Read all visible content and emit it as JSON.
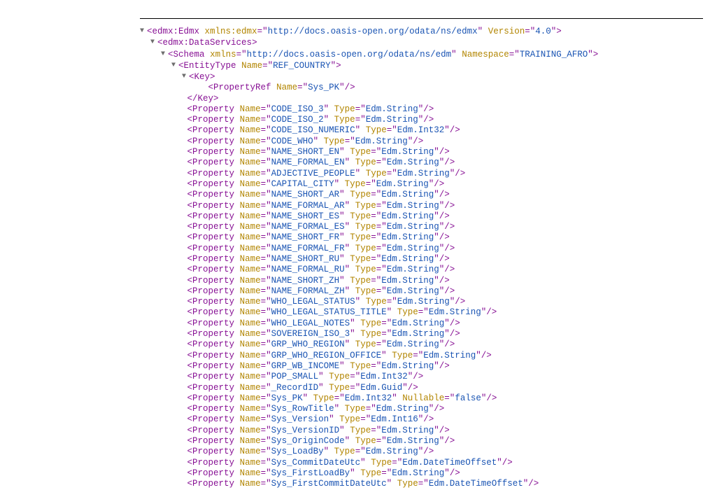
{
  "root": {
    "tag": "edmx:Edmx",
    "attrs": [
      {
        "name": "xmlns:edmx",
        "value": "http://docs.oasis-open.org/odata/ns/edmx"
      },
      {
        "name": "Version",
        "value": "4.0"
      }
    ]
  },
  "dataservices": {
    "tag": "edmx:DataServices"
  },
  "schema": {
    "tag": "Schema",
    "attrs": [
      {
        "name": "xmlns",
        "value": "http://docs.oasis-open.org/odata/ns/edm"
      },
      {
        "name": "Namespace",
        "value": "TRAINING_AFRO"
      }
    ]
  },
  "entitytype": {
    "tag": "EntityType",
    "attrs": [
      {
        "name": "Name",
        "value": "REF_COUNTRY"
      }
    ]
  },
  "key": {
    "tag": "Key",
    "propertyref": {
      "tag": "PropertyRef",
      "attrs": [
        {
          "name": "Name",
          "value": "Sys_PK"
        }
      ]
    },
    "close": "</Key>"
  },
  "properties": [
    {
      "tag": "Property",
      "attrs": [
        {
          "name": "Name",
          "value": "CODE_ISO_3"
        },
        {
          "name": "Type",
          "value": "Edm.String"
        }
      ]
    },
    {
      "tag": "Property",
      "attrs": [
        {
          "name": "Name",
          "value": "CODE_ISO_2"
        },
        {
          "name": "Type",
          "value": "Edm.String"
        }
      ]
    },
    {
      "tag": "Property",
      "attrs": [
        {
          "name": "Name",
          "value": "CODE_ISO_NUMERIC"
        },
        {
          "name": "Type",
          "value": "Edm.Int32"
        }
      ]
    },
    {
      "tag": "Property",
      "attrs": [
        {
          "name": "Name",
          "value": "CODE_WHO"
        },
        {
          "name": "Type",
          "value": "Edm.String"
        }
      ]
    },
    {
      "tag": "Property",
      "attrs": [
        {
          "name": "Name",
          "value": "NAME_SHORT_EN"
        },
        {
          "name": "Type",
          "value": "Edm.String"
        }
      ]
    },
    {
      "tag": "Property",
      "attrs": [
        {
          "name": "Name",
          "value": "NAME_FORMAL_EN"
        },
        {
          "name": "Type",
          "value": "Edm.String"
        }
      ]
    },
    {
      "tag": "Property",
      "attrs": [
        {
          "name": "Name",
          "value": "ADJECTIVE_PEOPLE"
        },
        {
          "name": "Type",
          "value": "Edm.String"
        }
      ]
    },
    {
      "tag": "Property",
      "attrs": [
        {
          "name": "Name",
          "value": "CAPITAL_CITY"
        },
        {
          "name": "Type",
          "value": "Edm.String"
        }
      ]
    },
    {
      "tag": "Property",
      "attrs": [
        {
          "name": "Name",
          "value": "NAME_SHORT_AR"
        },
        {
          "name": "Type",
          "value": "Edm.String"
        }
      ]
    },
    {
      "tag": "Property",
      "attrs": [
        {
          "name": "Name",
          "value": "NAME_FORMAL_AR"
        },
        {
          "name": "Type",
          "value": "Edm.String"
        }
      ]
    },
    {
      "tag": "Property",
      "attrs": [
        {
          "name": "Name",
          "value": "NAME_SHORT_ES"
        },
        {
          "name": "Type",
          "value": "Edm.String"
        }
      ]
    },
    {
      "tag": "Property",
      "attrs": [
        {
          "name": "Name",
          "value": "NAME_FORMAL_ES"
        },
        {
          "name": "Type",
          "value": "Edm.String"
        }
      ]
    },
    {
      "tag": "Property",
      "attrs": [
        {
          "name": "Name",
          "value": "NAME_SHORT_FR"
        },
        {
          "name": "Type",
          "value": "Edm.String"
        }
      ]
    },
    {
      "tag": "Property",
      "attrs": [
        {
          "name": "Name",
          "value": "NAME_FORMAL_FR"
        },
        {
          "name": "Type",
          "value": "Edm.String"
        }
      ]
    },
    {
      "tag": "Property",
      "attrs": [
        {
          "name": "Name",
          "value": "NAME_SHORT_RU"
        },
        {
          "name": "Type",
          "value": "Edm.String"
        }
      ]
    },
    {
      "tag": "Property",
      "attrs": [
        {
          "name": "Name",
          "value": "NAME_FORMAL_RU"
        },
        {
          "name": "Type",
          "value": "Edm.String"
        }
      ]
    },
    {
      "tag": "Property",
      "attrs": [
        {
          "name": "Name",
          "value": "NAME_SHORT_ZH"
        },
        {
          "name": "Type",
          "value": "Edm.String"
        }
      ]
    },
    {
      "tag": "Property",
      "attrs": [
        {
          "name": "Name",
          "value": "NAME_FORMAL_ZH"
        },
        {
          "name": "Type",
          "value": "Edm.String"
        }
      ]
    },
    {
      "tag": "Property",
      "attrs": [
        {
          "name": "Name",
          "value": "WHO_LEGAL_STATUS"
        },
        {
          "name": "Type",
          "value": "Edm.String"
        }
      ]
    },
    {
      "tag": "Property",
      "attrs": [
        {
          "name": "Name",
          "value": "WHO_LEGAL_STATUS_TITLE"
        },
        {
          "name": "Type",
          "value": "Edm.String"
        }
      ]
    },
    {
      "tag": "Property",
      "attrs": [
        {
          "name": "Name",
          "value": "WHO_LEGAL_NOTES"
        },
        {
          "name": "Type",
          "value": "Edm.String"
        }
      ]
    },
    {
      "tag": "Property",
      "attrs": [
        {
          "name": "Name",
          "value": "SOVEREIGN_ISO_3"
        },
        {
          "name": "Type",
          "value": "Edm.String"
        }
      ]
    },
    {
      "tag": "Property",
      "attrs": [
        {
          "name": "Name",
          "value": "GRP_WHO_REGION"
        },
        {
          "name": "Type",
          "value": "Edm.String"
        }
      ]
    },
    {
      "tag": "Property",
      "attrs": [
        {
          "name": "Name",
          "value": "GRP_WHO_REGION_OFFICE"
        },
        {
          "name": "Type",
          "value": "Edm.String"
        }
      ]
    },
    {
      "tag": "Property",
      "attrs": [
        {
          "name": "Name",
          "value": "GRP_WB_INCOME"
        },
        {
          "name": "Type",
          "value": "Edm.String"
        }
      ]
    },
    {
      "tag": "Property",
      "attrs": [
        {
          "name": "Name",
          "value": "POP_SMALL"
        },
        {
          "name": "Type",
          "value": "Edm.Int32"
        }
      ]
    },
    {
      "tag": "Property",
      "attrs": [
        {
          "name": "Name",
          "value": "_RecordID"
        },
        {
          "name": "Type",
          "value": "Edm.Guid"
        }
      ]
    },
    {
      "tag": "Property",
      "attrs": [
        {
          "name": "Name",
          "value": "Sys_PK"
        },
        {
          "name": "Type",
          "value": "Edm.Int32"
        },
        {
          "name": "Nullable",
          "value": "false"
        }
      ]
    },
    {
      "tag": "Property",
      "attrs": [
        {
          "name": "Name",
          "value": "Sys_RowTitle"
        },
        {
          "name": "Type",
          "value": "Edm.String"
        }
      ]
    },
    {
      "tag": "Property",
      "attrs": [
        {
          "name": "Name",
          "value": "Sys_Version"
        },
        {
          "name": "Type",
          "value": "Edm.Int16"
        }
      ]
    },
    {
      "tag": "Property",
      "attrs": [
        {
          "name": "Name",
          "value": "Sys_VersionID"
        },
        {
          "name": "Type",
          "value": "Edm.String"
        }
      ]
    },
    {
      "tag": "Property",
      "attrs": [
        {
          "name": "Name",
          "value": "Sys_OriginCode"
        },
        {
          "name": "Type",
          "value": "Edm.String"
        }
      ]
    },
    {
      "tag": "Property",
      "attrs": [
        {
          "name": "Name",
          "value": "Sys_LoadBy"
        },
        {
          "name": "Type",
          "value": "Edm.String"
        }
      ]
    },
    {
      "tag": "Property",
      "attrs": [
        {
          "name": "Name",
          "value": "Sys_CommitDateUtc"
        },
        {
          "name": "Type",
          "value": "Edm.DateTimeOffset"
        }
      ]
    },
    {
      "tag": "Property",
      "attrs": [
        {
          "name": "Name",
          "value": "Sys_FirstLoadBy"
        },
        {
          "name": "Type",
          "value": "Edm.String"
        }
      ]
    },
    {
      "tag": "Property",
      "attrs": [
        {
          "name": "Name",
          "value": "Sys_FirstCommitDateUtc"
        },
        {
          "name": "Type",
          "value": "Edm.DateTimeOffset"
        }
      ]
    }
  ]
}
